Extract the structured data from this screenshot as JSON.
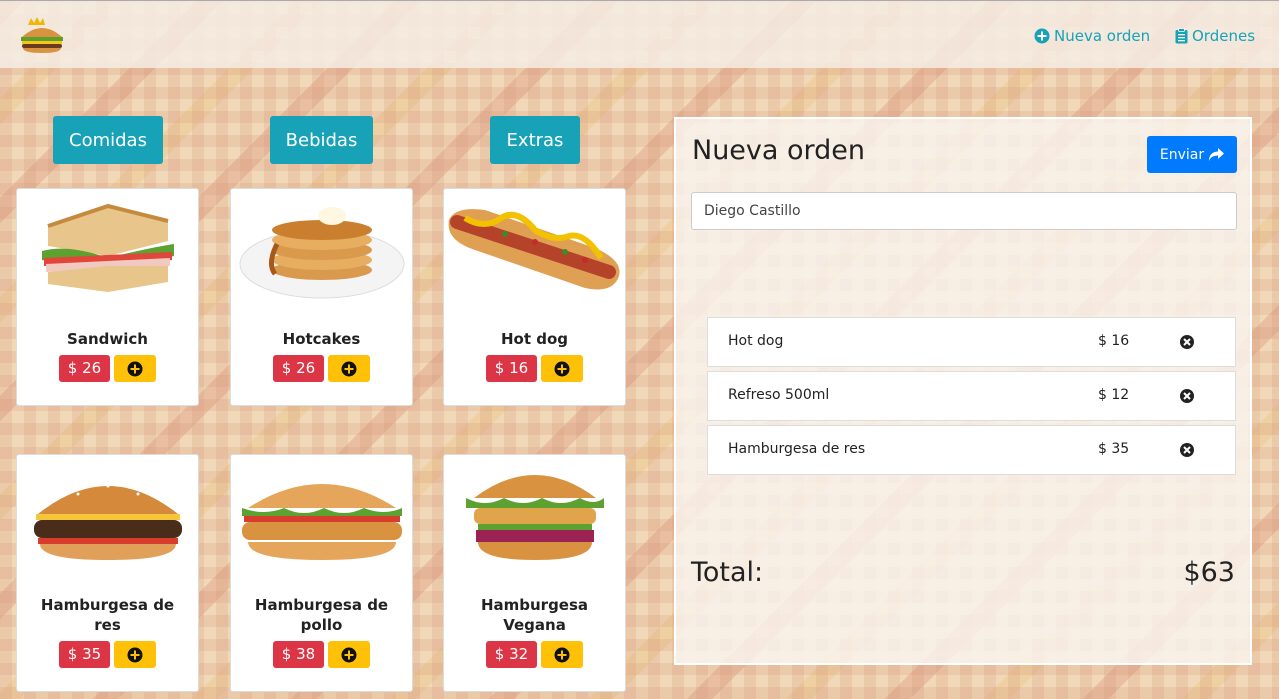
{
  "navbar": {
    "logo_icon": "burger-logo-icon",
    "new_order_label": "Nueva orden",
    "orders_label": "Ordenes",
    "link_color": "#17a2b8"
  },
  "categories": [
    "Comidas",
    "Bebidas",
    "Extras"
  ],
  "products": [
    {
      "name": "Sandwich",
      "price": "$ 26",
      "image": "sandwich-image"
    },
    {
      "name": "Hotcakes",
      "price": "$ 26",
      "image": "hotcakes-image"
    },
    {
      "name": "Hot dog",
      "price": "$ 16",
      "image": "hotdog-image"
    },
    {
      "name": "Hamburgesa de res",
      "price": "$ 35",
      "image": "beef-burger-image"
    },
    {
      "name": "Hamburgesa de pollo",
      "price": "$ 38",
      "image": "chicken-burger-image"
    },
    {
      "name": "Hamburgesa Vegana",
      "price": "$ 32",
      "image": "vegan-burger-image"
    }
  ],
  "order": {
    "title": "Nueva orden",
    "send_label": "Enviar",
    "customer_name": "Diego Castillo",
    "items": [
      {
        "name": "Hot dog",
        "price": "$ 16"
      },
      {
        "name": "Refreso 500ml",
        "price": "$ 12"
      },
      {
        "name": "Hamburgesa de res",
        "price": "$ 35"
      }
    ],
    "total_label": "Total:",
    "total_value": "$63"
  },
  "colors": {
    "category_button": "#17a2b8",
    "price_badge": "#dc3545",
    "add_button": "#ffc107",
    "send_button": "#007bff"
  }
}
